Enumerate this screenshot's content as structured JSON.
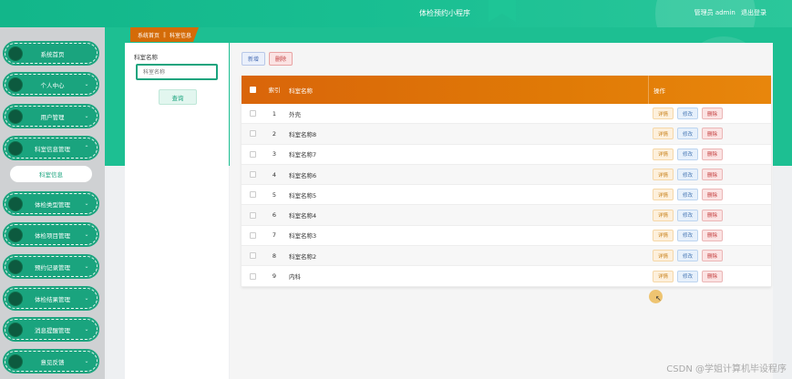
{
  "header": {
    "title": "体检预约小程序",
    "user_label": "管理员 admin",
    "logout": "退出登录"
  },
  "sidebar": {
    "items": [
      {
        "label": "系统首页",
        "chevron": ""
      },
      {
        "label": "个人中心",
        "chevron": "⌄"
      },
      {
        "label": "用户管理",
        "chevron": "⌄"
      },
      {
        "label": "科室信息管理",
        "chevron": "⌃"
      },
      {
        "label": "体检类型管理",
        "chevron": "⌄"
      },
      {
        "label": "体检项目管理",
        "chevron": "⌄"
      },
      {
        "label": "预约记录管理",
        "chevron": "⌄"
      },
      {
        "label": "体检结果管理",
        "chevron": "⌄"
      },
      {
        "label": "消息提醒管理",
        "chevron": "⌄"
      },
      {
        "label": "意见反馈",
        "chevron": "⌄"
      }
    ],
    "sub_item": "科室信息"
  },
  "breadcrumb": {
    "home": "系统首页",
    "separator": "‖",
    "current": "科室信息"
  },
  "filter": {
    "label": "科室名称",
    "placeholder": "科室名称",
    "query_button": "查询"
  },
  "toolbar": {
    "add": "新增",
    "delete": "删除"
  },
  "table": {
    "headers": {
      "index": "索引",
      "name": "科室名称",
      "ops": "操作"
    },
    "ops": {
      "detail": "详情",
      "edit": "修改",
      "delete": "删除"
    },
    "rows": [
      {
        "index": "1",
        "name": "外壳"
      },
      {
        "index": "2",
        "name": "科室名称8"
      },
      {
        "index": "3",
        "name": "科室名称7"
      },
      {
        "index": "4",
        "name": "科室名称6"
      },
      {
        "index": "5",
        "name": "科室名称5"
      },
      {
        "index": "6",
        "name": "科室名称4"
      },
      {
        "index": "7",
        "name": "科室名称3"
      },
      {
        "index": "8",
        "name": "科室名称2"
      },
      {
        "index": "9",
        "name": "内科"
      }
    ]
  },
  "watermark": "CSDN @学姐计算机毕设程序"
}
